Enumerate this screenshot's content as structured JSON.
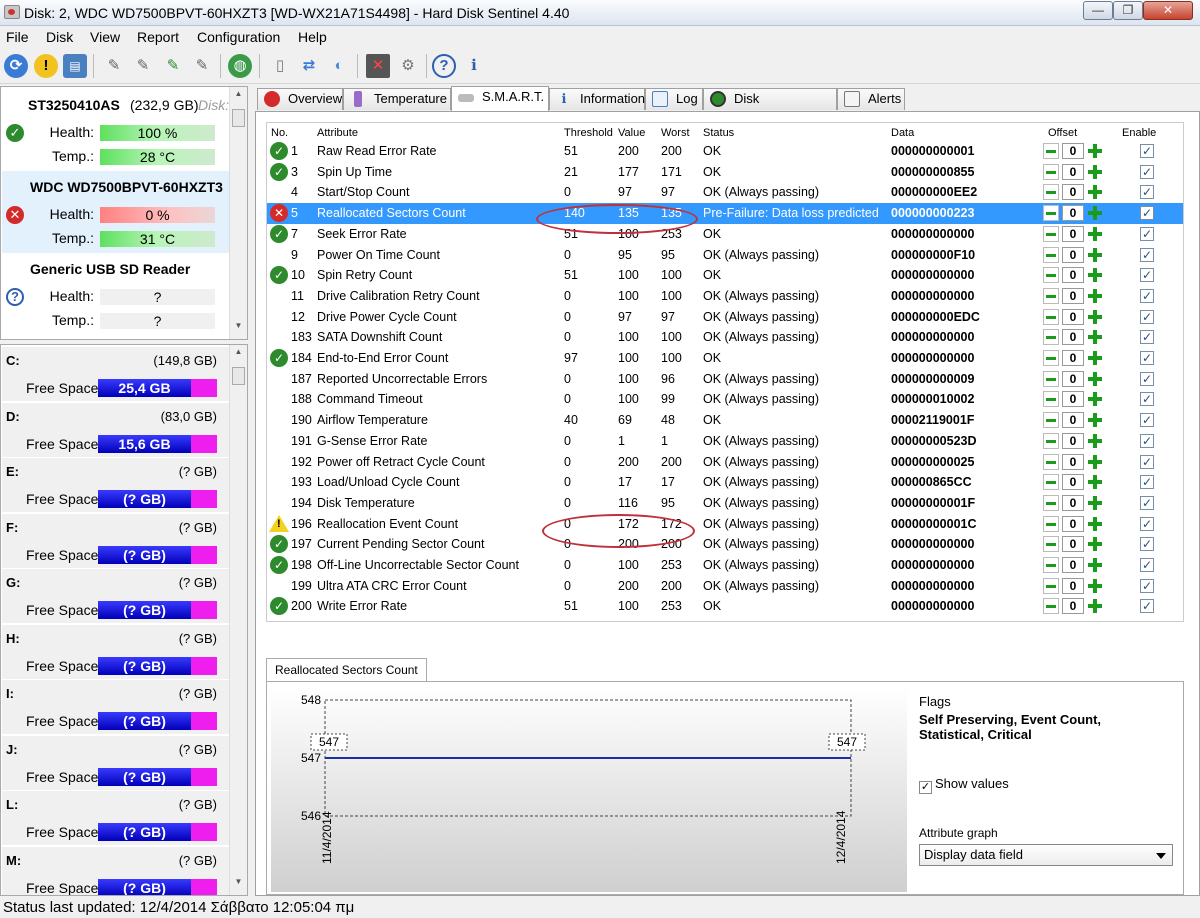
{
  "window": {
    "title": "Disk: 2, WDC WD7500BPVT-60HXZT3 [WD-WX21A71S4498]  -  Hard Disk Sentinel 4.40",
    "min": "—",
    "max": "❐",
    "close": "✕"
  },
  "menu": [
    "File",
    "Disk",
    "View",
    "Report",
    "Configuration",
    "Help"
  ],
  "disks": [
    {
      "name": "ST3250410AS",
      "size": "(232,9 GB)",
      "extra": "Disk:",
      "health_label": "Health:",
      "health": "100 %",
      "temp_label": "Temp.:",
      "temp": "28 °C",
      "status": "ok"
    },
    {
      "name": "WDC WD7500BPVT-60HXZT3",
      "size": "",
      "extra": "",
      "health_label": "Health:",
      "health": "0 %",
      "temp_label": "Temp.:",
      "temp": "31 °C",
      "status": "error"
    },
    {
      "name": "Generic USB SD Reader",
      "size": "",
      "extra": "",
      "health_label": "Health:",
      "health": "?",
      "temp_label": "Temp.:",
      "temp": "?",
      "status": "unknown"
    }
  ],
  "drives": [
    {
      "letter": "C:",
      "size": "(149,8 GB)",
      "free_label": "Free Space",
      "free": "25,4 GB"
    },
    {
      "letter": "D:",
      "size": "(83,0 GB)",
      "free_label": "Free Space",
      "free": "15,6 GB"
    },
    {
      "letter": "E:",
      "size": "(? GB)",
      "free_label": "Free Space",
      "free": "(? GB)"
    },
    {
      "letter": "F:",
      "size": "(? GB)",
      "free_label": "Free Space",
      "free": "(? GB)"
    },
    {
      "letter": "G:",
      "size": "(? GB)",
      "free_label": "Free Space",
      "free": "(? GB)"
    },
    {
      "letter": "H:",
      "size": "(? GB)",
      "free_label": "Free Space",
      "free": "(? GB)"
    },
    {
      "letter": "I:",
      "size": "(? GB)",
      "free_label": "Free Space",
      "free": "(? GB)"
    },
    {
      "letter": "J:",
      "size": "(? GB)",
      "free_label": "Free Space",
      "free": "(? GB)"
    },
    {
      "letter": "L:",
      "size": "(? GB)",
      "free_label": "Free Space",
      "free": "(? GB)"
    },
    {
      "letter": "M:",
      "size": "(? GB)",
      "free_label": "Free Space",
      "free": "(? GB)"
    }
  ],
  "tabs": [
    {
      "label": "Overview",
      "icon": "error-icon",
      "color": "#d42a2a"
    },
    {
      "label": "Temperature",
      "icon": "thermometer-icon",
      "color": "#9a6cc8"
    },
    {
      "label": "S.M.A.R.T.",
      "icon": "disk-icon",
      "color": "#999999"
    },
    {
      "label": "Information",
      "icon": "info-icon",
      "color": "#2d5fb0"
    },
    {
      "label": "Log",
      "icon": "log-icon",
      "color": "#4a7fc0"
    },
    {
      "label": "Disk Performance",
      "icon": "performance-icon",
      "color": "#2d8a2d"
    },
    {
      "label": "Alerts",
      "icon": "alerts-icon",
      "color": "#777777"
    }
  ],
  "smart": {
    "headers": {
      "no": "No.",
      "attribute": "Attribute",
      "threshold": "Threshold",
      "value": "Value",
      "worst": "Worst",
      "status": "Status",
      "data": "Data",
      "offset": "Offset",
      "enable": "Enable"
    },
    "rows": [
      {
        "icon": "ok",
        "no": "1",
        "attr": "Raw Read Error Rate",
        "thr": "51",
        "val": "200",
        "worst": "200",
        "status": "OK",
        "data": "000000000001",
        "offset": "0"
      },
      {
        "icon": "ok",
        "no": "3",
        "attr": "Spin Up Time",
        "thr": "21",
        "val": "177",
        "worst": "171",
        "status": "OK",
        "data": "000000000855",
        "offset": "0"
      },
      {
        "icon": "",
        "no": "4",
        "attr": "Start/Stop Count",
        "thr": "0",
        "val": "97",
        "worst": "97",
        "status": "OK (Always passing)",
        "data": "000000000EE2",
        "offset": "0"
      },
      {
        "icon": "error",
        "no": "5",
        "attr": "Reallocated Sectors Count",
        "thr": "140",
        "val": "135",
        "worst": "135",
        "status": "Pre-Failure: Data loss predicted",
        "data": "000000000223",
        "offset": "0",
        "selected": true
      },
      {
        "icon": "ok",
        "no": "7",
        "attr": "Seek Error Rate",
        "thr": "51",
        "val": "100",
        "worst": "253",
        "status": "OK",
        "data": "000000000000",
        "offset": "0"
      },
      {
        "icon": "",
        "no": "9",
        "attr": "Power On Time Count",
        "thr": "0",
        "val": "95",
        "worst": "95",
        "status": "OK (Always passing)",
        "data": "000000000F10",
        "offset": "0"
      },
      {
        "icon": "ok",
        "no": "10",
        "attr": "Spin Retry Count",
        "thr": "51",
        "val": "100",
        "worst": "100",
        "status": "OK",
        "data": "000000000000",
        "offset": "0"
      },
      {
        "icon": "",
        "no": "11",
        "attr": "Drive Calibration Retry Count",
        "thr": "0",
        "val": "100",
        "worst": "100",
        "status": "OK (Always passing)",
        "data": "000000000000",
        "offset": "0"
      },
      {
        "icon": "",
        "no": "12",
        "attr": "Drive Power Cycle Count",
        "thr": "0",
        "val": "97",
        "worst": "97",
        "status": "OK (Always passing)",
        "data": "000000000EDC",
        "offset": "0"
      },
      {
        "icon": "",
        "no": "183",
        "attr": "SATA Downshift Count",
        "thr": "0",
        "val": "100",
        "worst": "100",
        "status": "OK (Always passing)",
        "data": "000000000000",
        "offset": "0"
      },
      {
        "icon": "ok",
        "no": "184",
        "attr": "End-to-End Error Count",
        "thr": "97",
        "val": "100",
        "worst": "100",
        "status": "OK",
        "data": "000000000000",
        "offset": "0"
      },
      {
        "icon": "",
        "no": "187",
        "attr": "Reported Uncorrectable Errors",
        "thr": "0",
        "val": "100",
        "worst": "96",
        "status": "OK (Always passing)",
        "data": "000000000009",
        "offset": "0"
      },
      {
        "icon": "",
        "no": "188",
        "attr": "Command Timeout",
        "thr": "0",
        "val": "100",
        "worst": "99",
        "status": "OK (Always passing)",
        "data": "000000010002",
        "offset": "0"
      },
      {
        "icon": "",
        "no": "190",
        "attr": "Airflow Temperature",
        "thr": "40",
        "val": "69",
        "worst": "48",
        "status": "OK",
        "data": "00002119001F",
        "offset": "0"
      },
      {
        "icon": "",
        "no": "191",
        "attr": "G-Sense Error Rate",
        "thr": "0",
        "val": "1",
        "worst": "1",
        "status": "OK (Always passing)",
        "data": "00000000523D",
        "offset": "0"
      },
      {
        "icon": "",
        "no": "192",
        "attr": "Power off Retract Cycle Count",
        "thr": "0",
        "val": "200",
        "worst": "200",
        "status": "OK (Always passing)",
        "data": "000000000025",
        "offset": "0"
      },
      {
        "icon": "",
        "no": "193",
        "attr": "Load/Unload Cycle Count",
        "thr": "0",
        "val": "17",
        "worst": "17",
        "status": "OK (Always passing)",
        "data": "000000865CC",
        "offset": "0"
      },
      {
        "icon": "",
        "no": "194",
        "attr": "Disk Temperature",
        "thr": "0",
        "val": "116",
        "worst": "95",
        "status": "OK (Always passing)",
        "data": "00000000001F",
        "offset": "0"
      },
      {
        "icon": "warning",
        "no": "196",
        "attr": "Reallocation Event Count",
        "thr": "0",
        "val": "172",
        "worst": "172",
        "status": "OK (Always passing)",
        "data": "00000000001C",
        "offset": "0"
      },
      {
        "icon": "ok",
        "no": "197",
        "attr": "Current Pending Sector Count",
        "thr": "0",
        "val": "200",
        "worst": "200",
        "status": "OK (Always passing)",
        "data": "000000000000",
        "offset": "0"
      },
      {
        "icon": "ok",
        "no": "198",
        "attr": "Off-Line Uncorrectable Sector Count",
        "thr": "0",
        "val": "100",
        "worst": "253",
        "status": "OK (Always passing)",
        "data": "000000000000",
        "offset": "0"
      },
      {
        "icon": "",
        "no": "199",
        "attr": "Ultra ATA CRC Error Count",
        "thr": "0",
        "val": "200",
        "worst": "200",
        "status": "OK (Always passing)",
        "data": "000000000000",
        "offset": "0"
      },
      {
        "icon": "ok",
        "no": "200",
        "attr": "Write Error Rate",
        "thr": "51",
        "val": "100",
        "worst": "253",
        "status": "OK",
        "data": "000000000000",
        "offset": "0"
      }
    ]
  },
  "graph": {
    "tab_label": "Reallocated Sectors Count",
    "y_ticks": [
      "548",
      "547",
      "546"
    ],
    "x_ticks": [
      "11/4/2014",
      "12/4/2014"
    ],
    "point_labels": [
      "547",
      "547"
    ]
  },
  "chart_data": {
    "type": "line",
    "x": [
      "11/4/2014",
      "12/4/2014"
    ],
    "series": [
      {
        "values": [
          547,
          547
        ]
      }
    ],
    "ylim": [
      546,
      548
    ]
  },
  "flags": {
    "label": "Flags",
    "value": "Self Preserving, Event Count, Statistical, Critical"
  },
  "show_values": {
    "label": "Show values",
    "checked": "✓"
  },
  "attribute_graph": {
    "label": "Attribute graph",
    "selected": "Display data field"
  },
  "statusbar": "Status last updated: 12/4/2014 Σάββατο 12:05:04 πμ",
  "colors": {
    "selected_row": "#3399ff",
    "ok": "#2d8a2d",
    "error": "#d42a2a",
    "highlight_ellipse": "#c0303a",
    "free_space_bar": "#0000b8"
  }
}
